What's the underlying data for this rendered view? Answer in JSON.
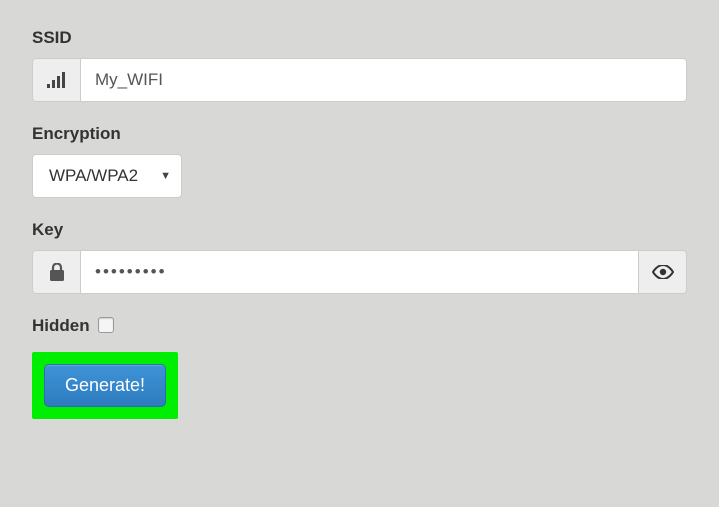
{
  "ssid": {
    "label": "SSID",
    "value": "My_WIFI",
    "icon": "signal-icon"
  },
  "encryption": {
    "label": "Encryption",
    "value": "WPA/WPA2"
  },
  "key": {
    "label": "Key",
    "value": "•••••••••",
    "leading_icon": "lock-icon",
    "trailing_icon": "eye-icon"
  },
  "hidden": {
    "label": "Hidden",
    "checked": false
  },
  "generate": {
    "label": "Generate!"
  }
}
